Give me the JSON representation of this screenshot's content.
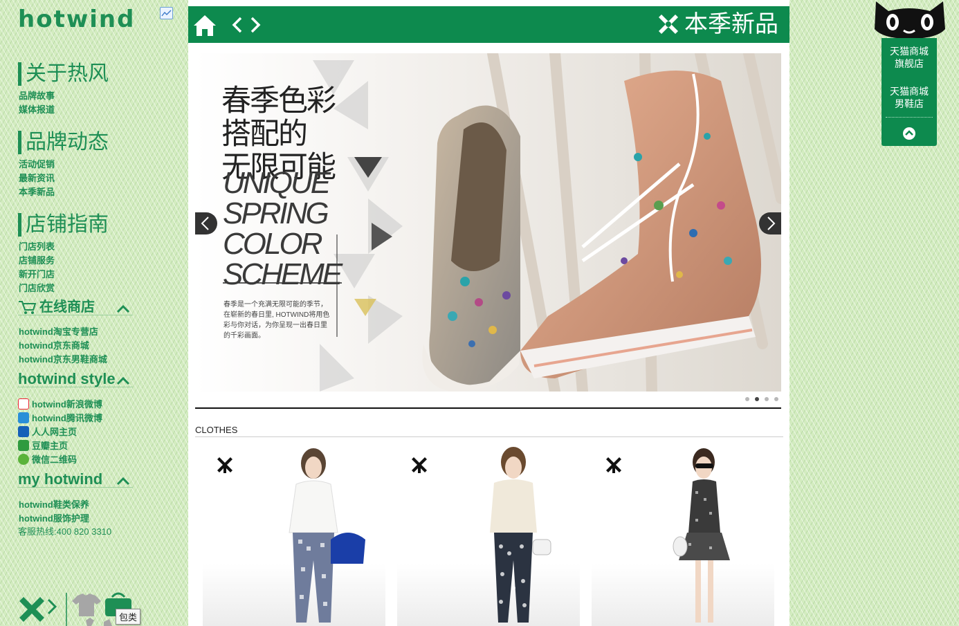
{
  "sidebar": {
    "logo": "hotwind",
    "sections": [
      {
        "title": "关于热风",
        "links": [
          "品牌故事",
          "媒体报道"
        ]
      },
      {
        "title": "品牌动态",
        "links": [
          "活动促销",
          "最新资讯",
          "本季新品"
        ]
      },
      {
        "title": "店铺指南",
        "links": [
          "门店列表",
          "店铺服务",
          "新开门店",
          "门店欣赏"
        ]
      }
    ],
    "online_store": {
      "title": "在线商店",
      "links": [
        "hotwind淘宝专营店",
        "hotwind京东商城",
        "hotwind京东男鞋商城"
      ]
    },
    "style": {
      "title": "hotwind style",
      "links": [
        "hotwind新浪微博",
        "hotwind腾讯微博",
        "人人网主页",
        "豆瓣主页",
        "微信二维码"
      ]
    },
    "my_hotwind": {
      "title": "my hotwind",
      "links": [
        "hotwind鞋类保养",
        "hotwind服饰护理"
      ],
      "hotline": "客服热线:400 820 3310"
    },
    "tooltip": "包类"
  },
  "header": {
    "season_title": "本季新品"
  },
  "slider": {
    "headline_cn": "春季色彩\n搭配的\n无限可能",
    "headline_en": "UNIQUE\nSPRING\nCOLOR\nSCHEME",
    "description": "春季是一个充满无限可能的季节，\n在崭新的春日里, HOTWIND将用色\n彩与你对话，为你呈现一出春日里\n的千彩画面。",
    "dots": 4,
    "active_dot": 1
  },
  "clothes": {
    "label": "CLOTHES",
    "count": 3
  },
  "tmall": {
    "flagship": "天猫商城\n旗舰店",
    "mens_shoes": "天猫商城\n男鞋店"
  },
  "colors": {
    "brand_green": "#0d8a4e",
    "text_green": "#1e8f55"
  }
}
